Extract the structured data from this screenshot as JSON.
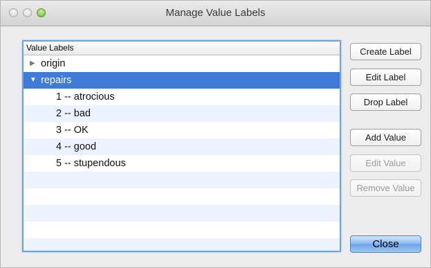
{
  "window": {
    "title": "Manage Value Labels"
  },
  "list": {
    "header": "Value Labels",
    "rows": [
      {
        "label": "origin",
        "expanded": false,
        "selected": false
      },
      {
        "label": "repairs",
        "expanded": true,
        "selected": true
      },
      {
        "label": "1 -- atrocious"
      },
      {
        "label": "2 -- bad"
      },
      {
        "label": "3 -- OK"
      },
      {
        "label": "4 -- good"
      },
      {
        "label": "5 -- stupendous"
      }
    ]
  },
  "buttons": {
    "create_label": "Create Label",
    "edit_label": "Edit Label",
    "drop_label": "Drop Label",
    "add_value": "Add Value",
    "edit_value": "Edit Value",
    "remove_value": "Remove Value",
    "close": "Close"
  },
  "colors": {
    "selection": "#3d7bd6",
    "stripe": "#edf3fe",
    "focus_ring": "#6ba3e3"
  }
}
